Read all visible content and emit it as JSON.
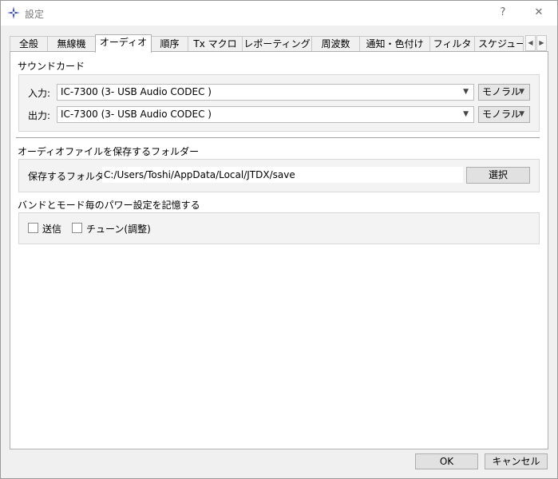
{
  "window": {
    "title": "設定",
    "help_glyph": "?",
    "close_glyph": "✕"
  },
  "tabs": [
    {
      "label": "全般"
    },
    {
      "label": "無線機"
    },
    {
      "label": "オーディオ",
      "active": true
    },
    {
      "label": "順序"
    },
    {
      "label": "Tx マクロ"
    },
    {
      "label": "レポーティング"
    },
    {
      "label": "周波数"
    },
    {
      "label": "通知・色付け"
    },
    {
      "label": "フィルタ"
    },
    {
      "label": "スケジューラ"
    }
  ],
  "tab_scroll": {
    "left": "◀",
    "right": "▶"
  },
  "soundcard": {
    "title": "サウンドカード",
    "input_label": "入力:",
    "input_value": "IC-7300 (3- USB Audio CODEC )",
    "input_channel": "モノラル",
    "output_label": "出力:",
    "output_value": "IC-7300 (3- USB Audio CODEC )",
    "output_channel": "モノラル",
    "arrow": "▼"
  },
  "save_folder": {
    "title": "オーディオファイルを保存するフォルダー",
    "label": "保存するフォルダー:",
    "path": "C:/Users/Toshi/AppData/Local/JTDX/save",
    "select_button": "選択"
  },
  "power": {
    "title": "バンドとモード毎のパワー設定を記憶する",
    "tx_label": "送信",
    "tx_checked": false,
    "tune_label": "チューン(調整)",
    "tune_checked": false
  },
  "footer": {
    "ok_label": "OK",
    "cancel_label": "キャンセル"
  }
}
